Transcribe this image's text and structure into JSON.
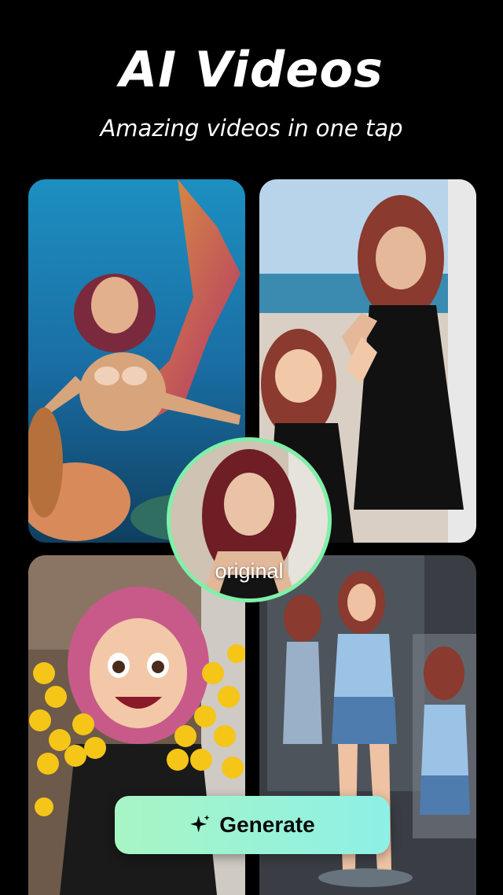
{
  "header": {
    "title": "AI Videos",
    "subtitle": "Amazing videos in one tap"
  },
  "gallery": {
    "tiles": [
      {
        "icon": "mermaid-photo"
      },
      {
        "icon": "high-five-photo"
      },
      {
        "icon": "cartoon-emoji-photo"
      },
      {
        "icon": "figurine-photo"
      }
    ],
    "original_label": "original"
  },
  "cta": {
    "label": "Generate",
    "icon": "sparkle-icon"
  },
  "colors": {
    "background": "#000000",
    "accent_border": "#7ff0a8",
    "button_start": "#a8f5c4",
    "button_end": "#8df0e6"
  }
}
